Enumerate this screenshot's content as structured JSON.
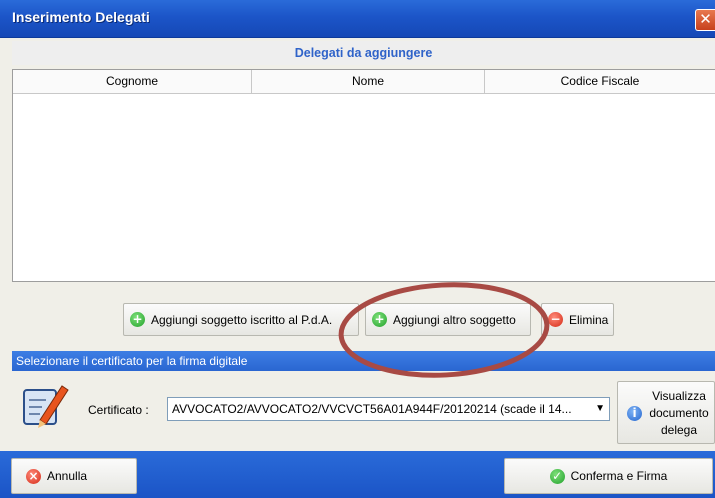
{
  "window": {
    "title": "Inserimento Delegati",
    "close_glyph": "✕"
  },
  "delegati": {
    "header": "Delegati da aggiungere",
    "columns": [
      "Cognome",
      "Nome",
      "Codice Fiscale"
    ],
    "rows": []
  },
  "actions": {
    "add_registered": "Aggiungi soggetto iscritto al P.d.A.",
    "add_other": "Aggiungi altro soggetto",
    "delete": "Elimina"
  },
  "certificate": {
    "section_header": "Selezionare il certificato per la firma digitale",
    "label": "Certificato :",
    "selected": "AVVOCATO2/AVVOCATO2/VVCVCT56A01A944F/20120214 (scade il 14...",
    "view_button": "Visualizza\ndocumento\ndelega"
  },
  "footer": {
    "cancel": "Annulla",
    "confirm": "Conferma e Firma"
  },
  "icons": {
    "add": "plus-circle-icon",
    "delete": "minus-circle-icon",
    "info": "info-icon",
    "cancel": "x-circle-icon",
    "confirm": "check-circle-icon",
    "certificate": "certificate-pen-icon"
  },
  "colors": {
    "titlebar": "#1c55c8",
    "header_text": "#2f63c9",
    "highlight_ellipse": "#a84a44"
  }
}
